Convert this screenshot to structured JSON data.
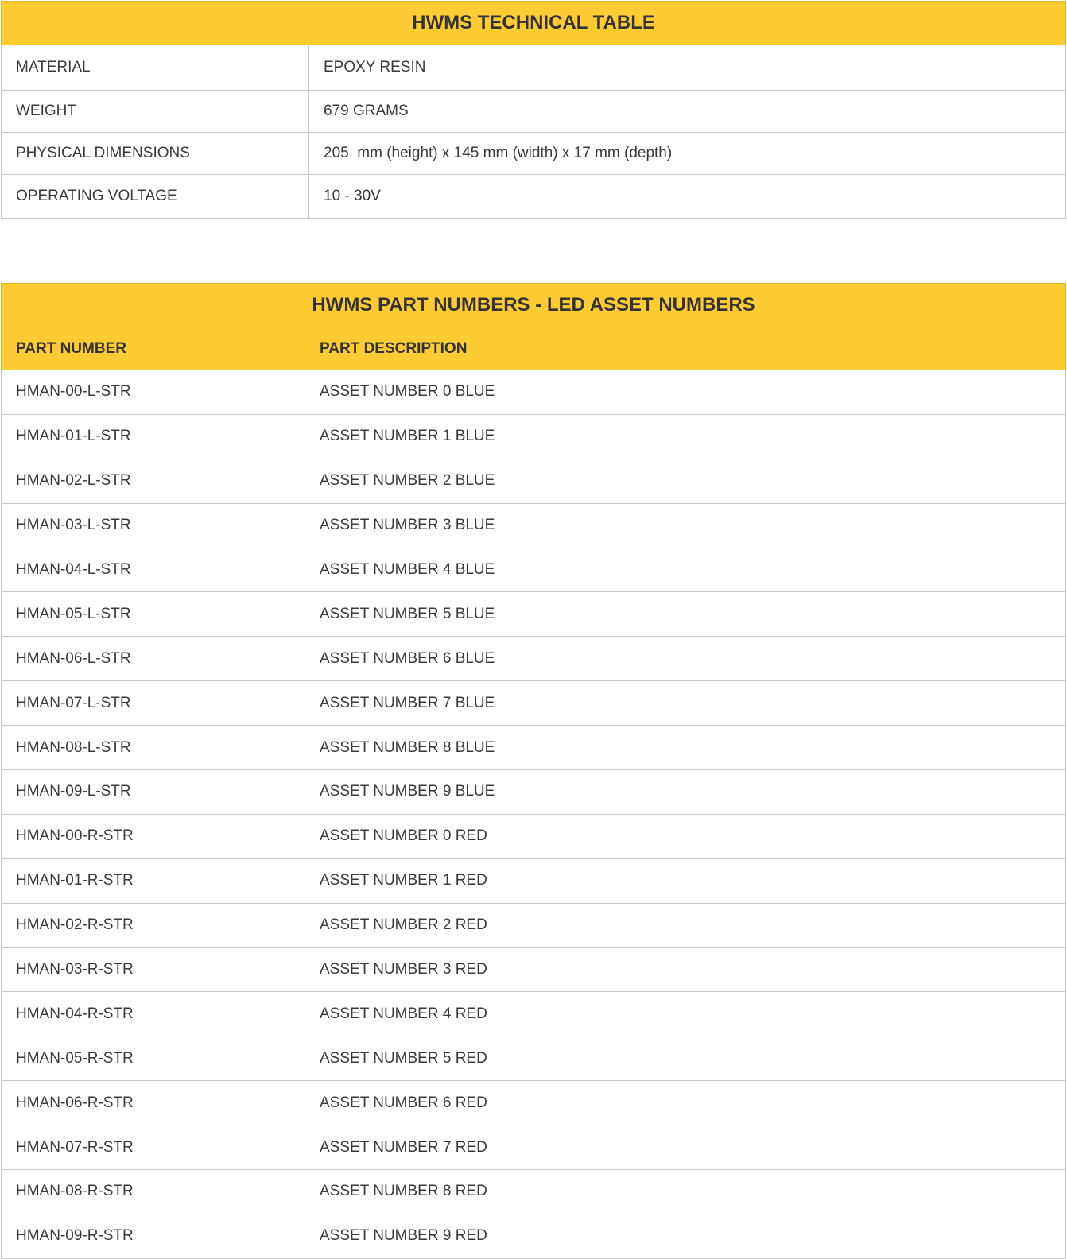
{
  "tech_table": {
    "title": "HWMS TECHNICAL TABLE",
    "rows": [
      {
        "label": "MATERIAL",
        "value": "EPOXY RESIN"
      },
      {
        "label": "WEIGHT",
        "value": "679 GRAMS"
      },
      {
        "label": "PHYSICAL DIMENSIONS",
        "value": "205  mm (height) x 145 mm (width) x 17 mm (depth)"
      },
      {
        "label": "OPERATING VOLTAGE",
        "value": "10 - 30V"
      }
    ]
  },
  "parts_table": {
    "title": "HWMS PART NUMBERS - LED ASSET NUMBERS",
    "headers": [
      "PART NUMBER",
      "PART DESCRIPTION"
    ],
    "rows": [
      {
        "part": "HMAN-00-L-STR",
        "desc": "ASSET NUMBER 0 BLUE"
      },
      {
        "part": "HMAN-01-L-STR",
        "desc": "ASSET NUMBER 1 BLUE"
      },
      {
        "part": "HMAN-02-L-STR",
        "desc": "ASSET NUMBER 2 BLUE"
      },
      {
        "part": "HMAN-03-L-STR",
        "desc": "ASSET NUMBER 3 BLUE"
      },
      {
        "part": "HMAN-04-L-STR",
        "desc": "ASSET NUMBER 4 BLUE"
      },
      {
        "part": "HMAN-05-L-STR",
        "desc": "ASSET NUMBER 5 BLUE"
      },
      {
        "part": "HMAN-06-L-STR",
        "desc": "ASSET NUMBER 6 BLUE"
      },
      {
        "part": "HMAN-07-L-STR",
        "desc": "ASSET NUMBER 7 BLUE"
      },
      {
        "part": "HMAN-08-L-STR",
        "desc": "ASSET NUMBER 8 BLUE"
      },
      {
        "part": "HMAN-09-L-STR",
        "desc": "ASSET NUMBER 9 BLUE"
      },
      {
        "part": "HMAN-00-R-STR",
        "desc": "ASSET NUMBER 0 RED"
      },
      {
        "part": "HMAN-01-R-STR",
        "desc": "ASSET NUMBER 1 RED"
      },
      {
        "part": "HMAN-02-R-STR",
        "desc": "ASSET NUMBER 2 RED"
      },
      {
        "part": "HMAN-03-R-STR",
        "desc": "ASSET NUMBER 3 RED"
      },
      {
        "part": "HMAN-04-R-STR",
        "desc": "ASSET NUMBER 4 RED"
      },
      {
        "part": "HMAN-05-R-STR",
        "desc": "ASSET NUMBER 5 RED"
      },
      {
        "part": "HMAN-06-R-STR",
        "desc": "ASSET NUMBER 6 RED"
      },
      {
        "part": "HMAN-07-R-STR",
        "desc": "ASSET NUMBER 7 RED"
      },
      {
        "part": "HMAN-08-R-STR",
        "desc": "ASSET NUMBER 8 RED"
      },
      {
        "part": "HMAN-09-R-STR",
        "desc": "ASSET NUMBER 9 RED"
      }
    ]
  },
  "colors": {
    "header_background": "#fecb33",
    "border": "#c8c8c8",
    "text": "#3a3a3a"
  }
}
